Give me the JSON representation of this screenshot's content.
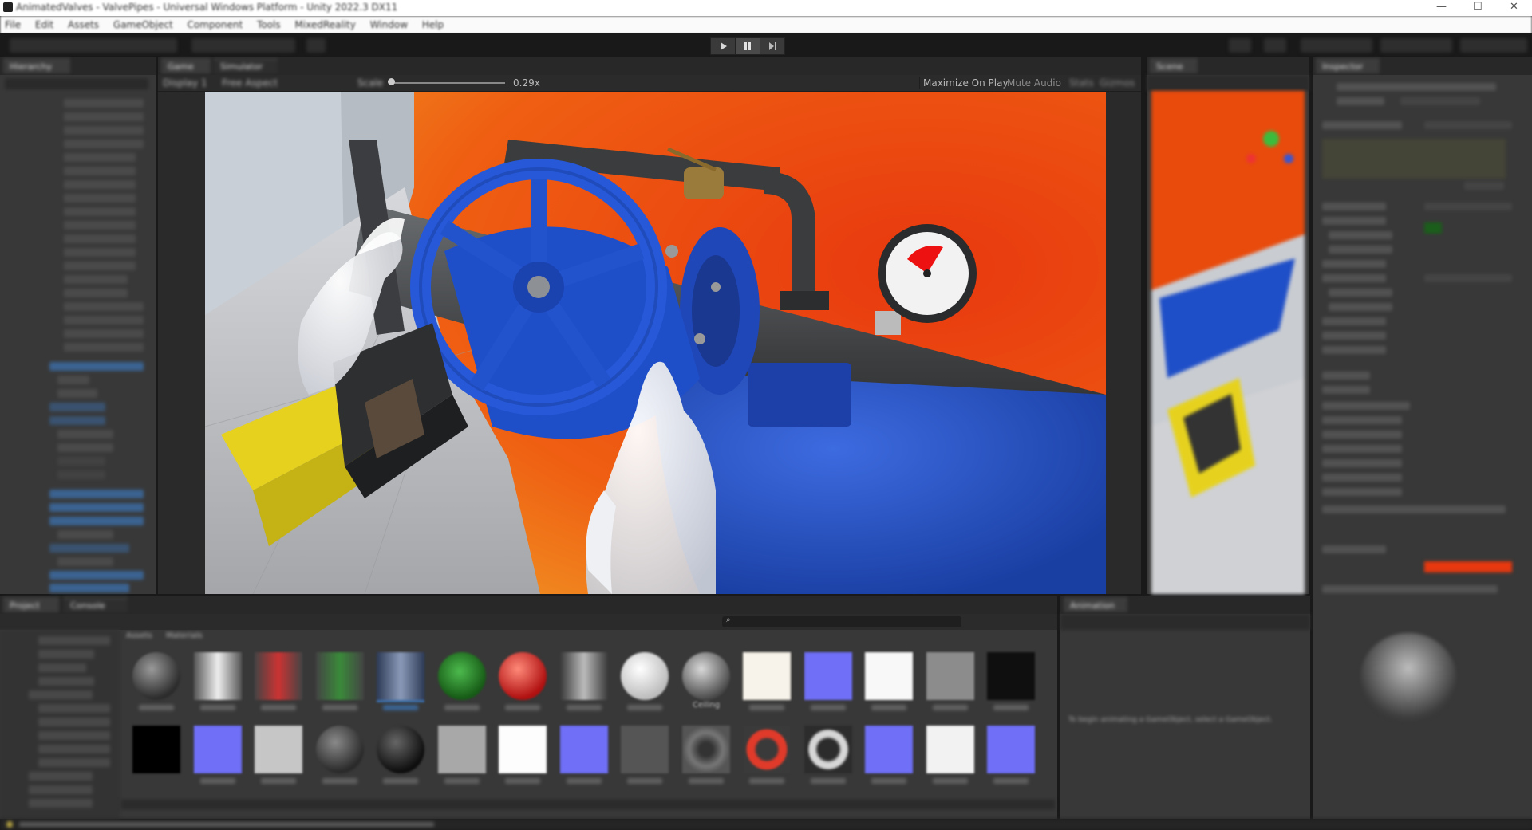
{
  "window": {
    "title": "AnimatedValves - ValvePipes - Universal Windows Platform - Unity 2022.3 DX11"
  },
  "menu": [
    "File",
    "Edit",
    "Assets",
    "GameObject",
    "Component",
    "Tools",
    "MixedReality",
    "Window",
    "Help"
  ],
  "toolbar": {
    "play_icon": "play-icon",
    "pause_icon": "pause-icon",
    "step_icon": "step-icon"
  },
  "hierarchy": {
    "tab": "Hierarchy"
  },
  "game": {
    "tab": "Game",
    "tab2": "Simulator",
    "display": "Display 1",
    "resolution": "Free Aspect",
    "scale_label": "Scale",
    "scale_value": "0.29x",
    "maximize": "Maximize On Play",
    "mute": "Mute Audio",
    "stats": "Stats",
    "gizmos": "Gizmos"
  },
  "scene": {
    "tab": "Scene"
  },
  "inspector": {
    "tab": "Inspector"
  },
  "project": {
    "tab": "Project",
    "tab2": "Console",
    "breadcrumb1": "Assets",
    "breadcrumb2": "Materials",
    "materials_row2_labels": [
      "",
      "",
      "",
      "",
      "",
      "Ceiling",
      "",
      "",
      "",
      "",
      "",
      "",
      "",
      ""
    ]
  },
  "console": {
    "tab": "Animation",
    "message": "To begin animating a GameObject, select a GameObject."
  },
  "colors": {
    "brand": "#e84b0c",
    "valve_blue": "#1f4fc8",
    "selection": "#3c6ea8"
  }
}
